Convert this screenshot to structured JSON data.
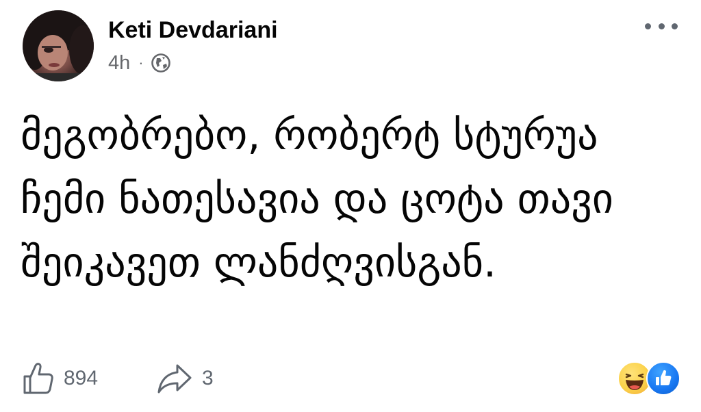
{
  "post": {
    "author": "Keti Devdariani",
    "time": "4h",
    "separator": "·",
    "audience_icon": "globe-icon",
    "text": "მეგობრებო, რობერტ სტურუა ჩემი ნათესავია და ცოტა თავი შეიკავეთ ლანძღვისგან."
  },
  "footer": {
    "like_icon": "thumbs-up-icon",
    "like_count": "894",
    "share_icon": "share-arrow-icon",
    "share_count": "3",
    "reactions": [
      "haha",
      "like"
    ]
  },
  "colors": {
    "text_primary": "#050505",
    "text_secondary": "#65676b",
    "reaction_like_blue": "#1877f2",
    "reaction_haha_yellow": "#fbd24a"
  }
}
